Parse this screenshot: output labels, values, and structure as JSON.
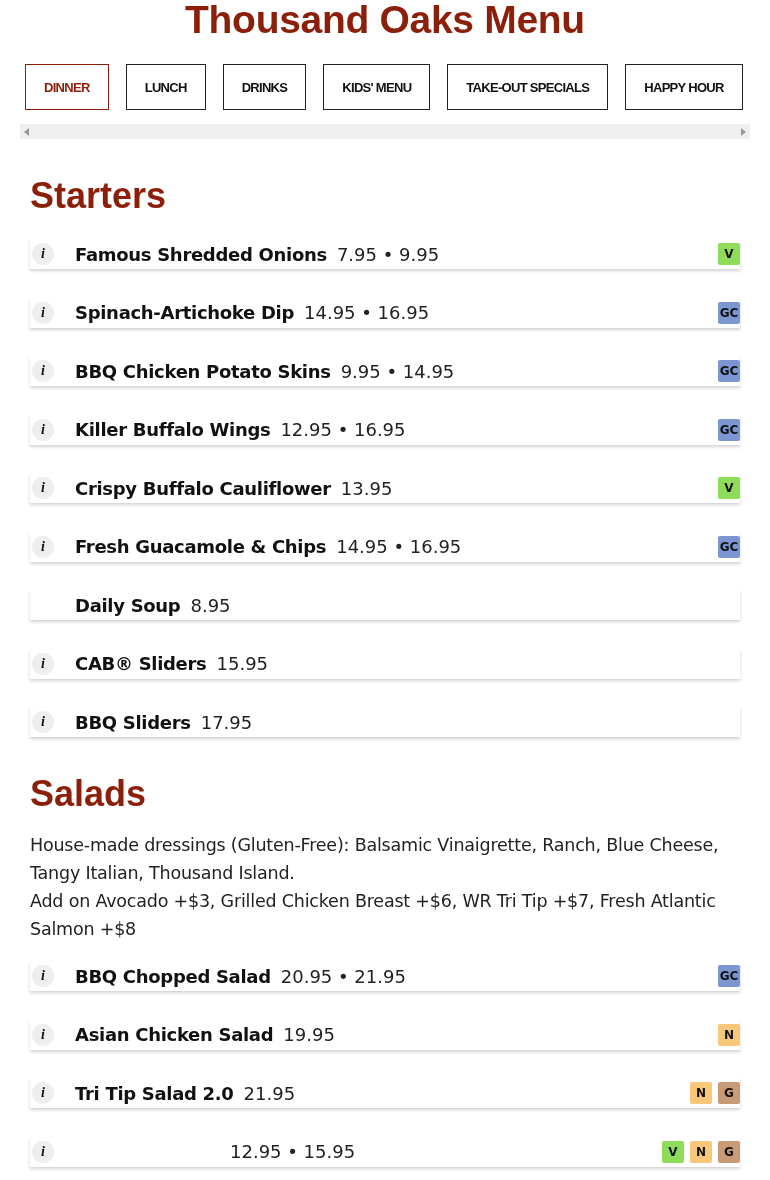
{
  "title": "Thousand Oaks Menu",
  "tabs": [
    {
      "label": "DINNER",
      "selected": true
    },
    {
      "label": "LUNCH",
      "selected": false
    },
    {
      "label": "DRINKS",
      "selected": false
    },
    {
      "label": "KIDS' MENU",
      "selected": false
    },
    {
      "label": "TAKE-OUT SPECIALS",
      "selected": false
    },
    {
      "label": "HAPPY HOUR",
      "selected": false
    }
  ],
  "sections": [
    {
      "heading": "Starters",
      "items": [
        {
          "info": "i",
          "name": "Famous Shredded Onions",
          "price": "7.95 • 9.95",
          "tags": [
            {
              "label": "V",
              "color": "#8fdc5a"
            }
          ]
        },
        {
          "info": "i",
          "name": "Spinach-Artichoke Dip",
          "price": "14.95 • 16.95",
          "tags": [
            {
              "label": "GC",
              "color": "#7b96d0"
            }
          ]
        },
        {
          "info": "i",
          "name": "BBQ Chicken Potato Skins",
          "price": "9.95 • 14.95",
          "tags": [
            {
              "label": "GC",
              "color": "#7b96d0"
            }
          ]
        },
        {
          "info": "i",
          "name": "Killer Buffalo Wings",
          "price": "12.95 • 16.95",
          "tags": [
            {
              "label": "GC",
              "color": "#7b96d0"
            }
          ]
        },
        {
          "info": "i",
          "name": "Crispy Buffalo Cauliflower",
          "price": "13.95",
          "tags": [
            {
              "label": "V",
              "color": "#8fdc5a"
            }
          ]
        },
        {
          "info": "i",
          "name": "Fresh Guacamole & Chips",
          "price": "14.95 • 16.95",
          "tags": [
            {
              "label": "GC",
              "color": "#7b96d0"
            }
          ]
        },
        {
          "name": "Daily Soup",
          "price": "8.95"
        },
        {
          "info": "i",
          "name": "CAB® Sliders",
          "price": "15.95"
        },
        {
          "info": "i",
          "name": "BBQ Sliders",
          "price": "17.95"
        }
      ]
    },
    {
      "heading": "Salads",
      "notes": [
        "House-made dressings (Gluten-Free): Balsamic Vinaigrette, Ranch, Blue Cheese, Tangy Italian, Thousand Island.",
        "Add on Avocado +$3, Grilled Chicken Breast +$6, WR Tri Tip +$7, Fresh Atlantic Salmon +$8"
      ],
      "items": [
        {
          "info": "i",
          "name": "BBQ Chopped Salad",
          "price": "20.95 • 21.95",
          "tags": [
            {
              "label": "GC",
              "color": "#7b96d0"
            }
          ]
        },
        {
          "info": "i",
          "name": "Asian Chicken Salad",
          "price": "19.95",
          "tags": [
            {
              "label": "N",
              "color": "#f9c77a"
            }
          ]
        },
        {
          "info": "i",
          "name": "Tri Tip Salad 2.0",
          "price": "21.95",
          "tags": [
            {
              "label": "N",
              "color": "#f9c77a"
            },
            {
              "label": "G",
              "color": "#c99a76"
            }
          ]
        },
        {
          "info": "i",
          "price": "12.95 • 15.95",
          "tags": [
            {
              "label": "V",
              "color": "#8fdc5a"
            },
            {
              "label": "N",
              "color": "#f9c77a"
            },
            {
              "label": "G",
              "color": "#c99a76"
            }
          ]
        }
      ]
    }
  ]
}
